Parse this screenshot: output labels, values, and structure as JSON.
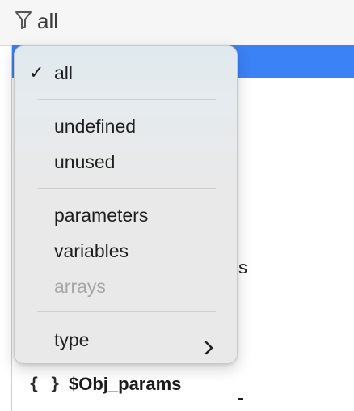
{
  "filter": {
    "icon": "filter-icon",
    "label": "all"
  },
  "list": {
    "peek_text": "s",
    "rows": [
      {
        "icon": "braces-icon",
        "braces": "{ }",
        "label": "$Obj_params"
      },
      {
        "icon": "braces-icon",
        "braces": "{ }",
        "label": ""
      }
    ]
  },
  "menu": {
    "checked_glyph": "✓",
    "items": {
      "all": {
        "label": "all",
        "checked": true
      },
      "undefined": {
        "label": "undefined"
      },
      "unused": {
        "label": "unused"
      },
      "parameters": {
        "label": "parameters"
      },
      "variables": {
        "label": "variables"
      },
      "arrays": {
        "label": "arrays",
        "disabled": true
      },
      "type": {
        "label": "type",
        "submenu_icon": "chevron-right-icon"
      }
    }
  },
  "colors": {
    "selection": "#3b82f6",
    "menu_text": "#1e1e1e",
    "disabled_text": "#a6a6a6"
  }
}
